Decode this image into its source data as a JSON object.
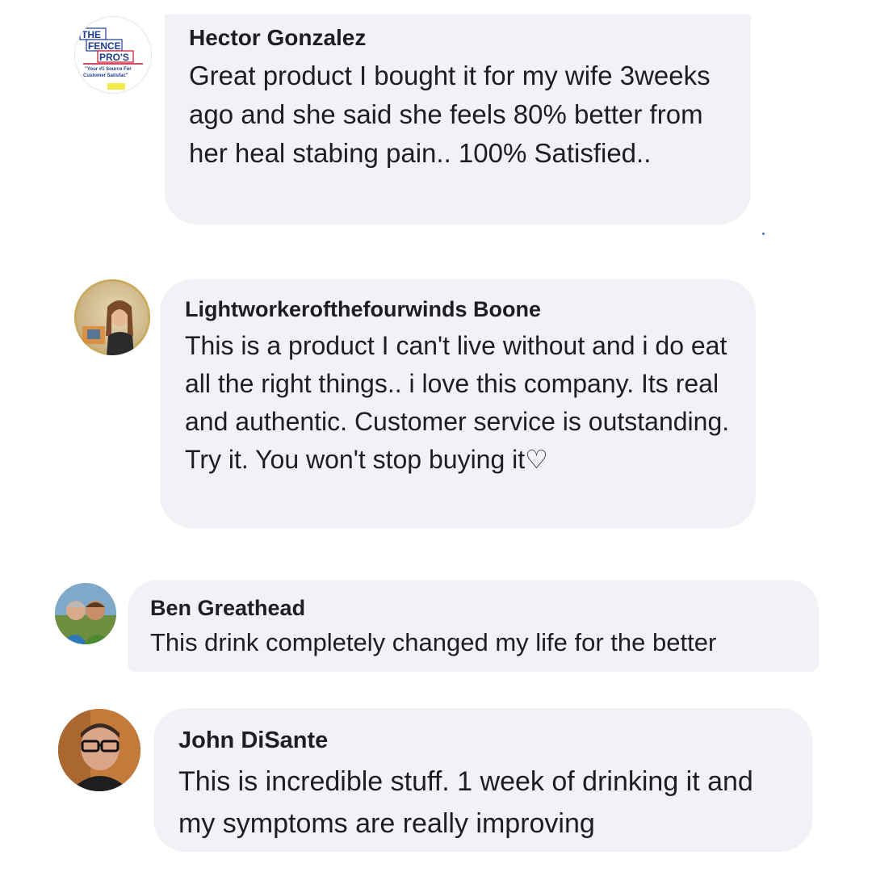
{
  "comments": [
    {
      "author": "Hector Gonzalez",
      "text": "Great product I bought it for my wife 3weeks ago and she said she feels 80% better from her heal stabing pain.. 100% Satisfied..",
      "avatar_logo": {
        "line1": "THE",
        "line2": "FENCE",
        "line3": "PRO'S",
        "tagline1": "\"Your #1 Source For",
        "tagline2": "Customer Satisfac\""
      }
    },
    {
      "author": "Lightworkerofthefourwinds Boone",
      "text": "This is a product I can't live without and i do eat all the right things.. i love this company. Its real and authentic. Customer service is outstanding. Try it. You won't stop buying it♡"
    },
    {
      "author": "Ben Greathead",
      "text": "This drink completely changed my life for the better"
    },
    {
      "author": "John DiSante",
      "text": "This is incredible stuff. 1 week of drinking it and my symptoms are really improving"
    }
  ],
  "colors": {
    "bubble_background": "#f0f2f5",
    "text": "#1c1e21",
    "page_background": "#ffffff"
  }
}
